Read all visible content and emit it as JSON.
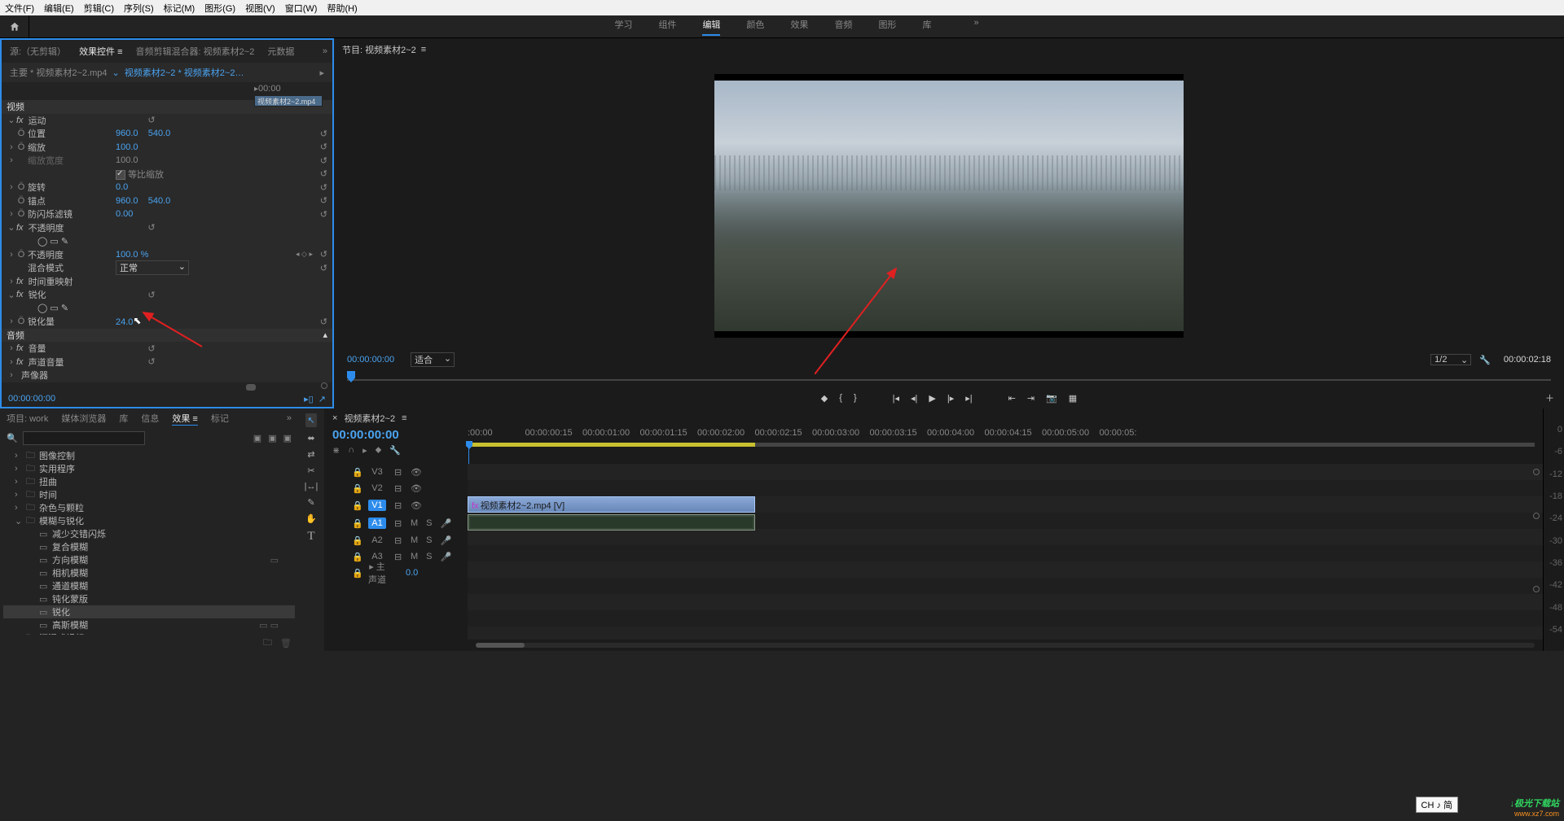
{
  "menubar": [
    "文件(F)",
    "编辑(E)",
    "剪辑(C)",
    "序列(S)",
    "标记(M)",
    "图形(G)",
    "视图(V)",
    "窗口(W)",
    "帮助(H)"
  ],
  "workspaces": {
    "items": [
      "学习",
      "组件",
      "编辑",
      "颜色",
      "效果",
      "音频",
      "图形",
      "库"
    ],
    "active": 2
  },
  "source_panel": {
    "tabs": [
      "源:（无剪辑）",
      "效果控件",
      "音频剪辑混合器: 视频素材2~2",
      "元数据"
    ],
    "active": 1,
    "breadcrumb": {
      "master": "主要 * 视频素材2~2.mp4",
      "seq": "视频素材2~2 * 视频素材2~2…"
    },
    "mini_time": "00:00",
    "mini_clip": "视频素材2~2.mp4",
    "footer_tc": "00:00:00:00",
    "sections": {
      "video": "视频",
      "motion": {
        "label": "运动",
        "position": {
          "label": "位置",
          "x": "960.0",
          "y": "540.0"
        },
        "scale": {
          "label": "缩放",
          "v": "100.0"
        },
        "scalew": {
          "label": "缩放宽度",
          "v": "100.0"
        },
        "uniform": {
          "label": "等比缩放",
          "checked": true
        },
        "rotation": {
          "label": "旋转",
          "v": "0.0"
        },
        "anchor": {
          "label": "锚点",
          "x": "960.0",
          "y": "540.0"
        },
        "flicker": {
          "label": "防闪烁滤镜",
          "v": "0.00"
        }
      },
      "opacity": {
        "label": "不透明度",
        "amount": {
          "label": "不透明度",
          "v": "100.0 %"
        },
        "blend": {
          "label": "混合模式",
          "v": "正常"
        }
      },
      "timeremap": {
        "label": "时间重映射"
      },
      "sharpen": {
        "label": "锐化",
        "amount": {
          "label": "锐化量",
          "v": "24.0"
        }
      },
      "audio": "音频",
      "volume": {
        "label": "音量"
      },
      "chvolume": {
        "label": "声道音量"
      },
      "panner": {
        "label": "声像器"
      }
    }
  },
  "program": {
    "title": "节目: 视频素材2~2",
    "tc": "00:00:00:00",
    "fit": "适合",
    "zoom": "1/2",
    "duration": "00:00:02:18"
  },
  "project_panel": {
    "tabs": [
      "项目: work",
      "媒体浏览器",
      "库",
      "信息",
      "效果",
      "标记"
    ],
    "active": 4,
    "search_placeholder": "",
    "tree": [
      {
        "l": 1,
        "tw": "›",
        "t": "folder",
        "label": "图像控制"
      },
      {
        "l": 1,
        "tw": "›",
        "t": "folder",
        "label": "实用程序"
      },
      {
        "l": 1,
        "tw": "›",
        "t": "folder",
        "label": "扭曲"
      },
      {
        "l": 1,
        "tw": "›",
        "t": "folder",
        "label": "时间"
      },
      {
        "l": 1,
        "tw": "›",
        "t": "folder",
        "label": "杂色与颗粒"
      },
      {
        "l": 1,
        "tw": "⌄",
        "t": "folder",
        "label": "模糊与锐化"
      },
      {
        "l": 2,
        "t": "preset",
        "label": "减少交错闪烁"
      },
      {
        "l": 2,
        "t": "preset",
        "label": "复合模糊"
      },
      {
        "l": 2,
        "t": "preset",
        "label": "方向模糊",
        "short": "▭"
      },
      {
        "l": 2,
        "t": "preset",
        "label": "相机模糊"
      },
      {
        "l": 2,
        "t": "preset",
        "label": "通道模糊"
      },
      {
        "l": 2,
        "t": "preset",
        "label": "钝化蒙版"
      },
      {
        "l": 2,
        "t": "preset",
        "label": "锐化",
        "sel": true
      },
      {
        "l": 2,
        "t": "preset",
        "label": "高斯模糊",
        "short": "▭ ▭"
      },
      {
        "l": 1,
        "tw": "›",
        "t": "folder",
        "label": "沉浸式视频"
      }
    ]
  },
  "timeline": {
    "title": "视频素材2~2",
    "tc": "00:00:00:00",
    "ruler": [
      ":00:00",
      "00:00:00:15",
      "00:00:01:00",
      "00:00:01:15",
      "00:00:02:00",
      "00:00:02:15",
      "00:00:03:00",
      "00:00:03:15",
      "00:00:04:00",
      "00:00:04:15",
      "00:00:05:00",
      "00:00:05:"
    ],
    "tracks_v": [
      {
        "name": "V3"
      },
      {
        "name": "V2"
      },
      {
        "name": "V1",
        "hl": true
      }
    ],
    "tracks_a": [
      {
        "name": "A1",
        "hl": true,
        "ms": true
      },
      {
        "name": "A2",
        "ms": true
      },
      {
        "name": "A3",
        "ms": true
      }
    ],
    "master": {
      "label": "主声道",
      "v": "0.0"
    },
    "clip": {
      "label": "视频素材2~2.mp4 [V]"
    }
  },
  "meter": [
    "0",
    "-6",
    "-12",
    "-18",
    "-24",
    "-30",
    "-36",
    "-42",
    "-48",
    "-54"
  ],
  "ime": "CH ♪ 简",
  "logo": {
    "brand": "↓极光下载站",
    "url": "www.xz7.com"
  }
}
